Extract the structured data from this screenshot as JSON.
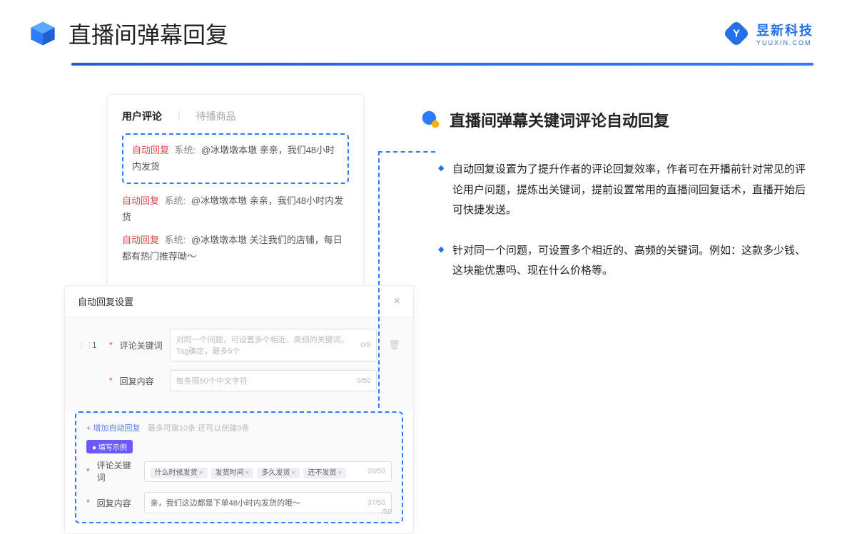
{
  "header": {
    "title": "直播间弹幕回复",
    "brand_name": "昱新科技",
    "brand_sub": "YUUXIN.COM"
  },
  "tabs": {
    "active": "用户评论",
    "inactive": "待播商品"
  },
  "highlight_comment": {
    "tag": "自动回复",
    "sys": "系统:",
    "text": "@冰墩墩本墩 亲亲，我们48小时内发货"
  },
  "comments": [
    {
      "tag": "自动回复",
      "sys": "系统:",
      "text": "@冰墩墩本墩 亲亲，我们48小时内发货"
    },
    {
      "tag": "自动回复",
      "sys": "系统:",
      "text": "@冰墩墩本墩 关注我们的店铺，每日都有热门推荐呦～"
    }
  ],
  "dialog": {
    "title": "自动回复设置",
    "row_num": "1",
    "label_keyword": "评论关键词",
    "placeholder_keyword": "对同一个问题，可设置多个相近、高频的关键词，Tag确定，最多5个",
    "count_keyword": "0/8",
    "label_content": "回复内容",
    "placeholder_content": "每条限50个中文字符",
    "count_content": "0/50",
    "add_link": "+ 增加自动回复",
    "add_hint": "最多可建10条 还可以创建9条",
    "example_badge": "● 填写示例",
    "ex_label_kw": "评论关键词",
    "ex_tags": [
      "什么时候发货",
      "发货时间",
      "多久发货",
      "还不发货"
    ],
    "ex_count_kw": "20/50",
    "ex_label_ct": "回复内容",
    "ex_content": "亲，我们这边都是下单48小时内发货的哦～",
    "ex_count_ct": "37/50",
    "outside_count": "/50"
  },
  "right": {
    "subtitle": "直播间弹幕关键词评论自动回复",
    "bullets": [
      "自动回复设置为了提升作者的评论回复效率，作者可在开播前针对常见的评论用户问题，提炼出关键词，提前设置常用的直播间回复话术，直播开始后可快捷发送。",
      "针对同一个问题，可设置多个相近的、高频的关键词。例如：这款多少钱、这块能优惠吗、现在什么价格等。"
    ]
  }
}
